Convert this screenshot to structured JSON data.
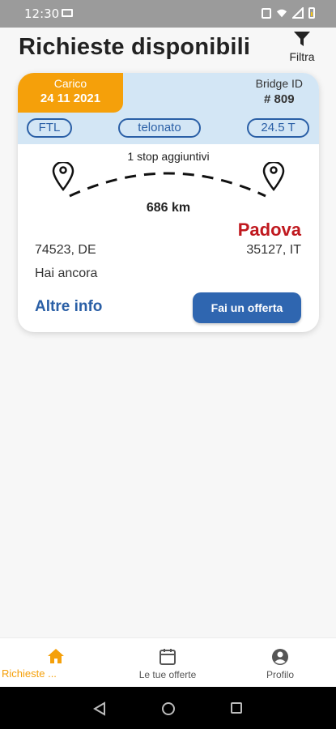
{
  "status_bar": {
    "time": "12:30"
  },
  "header": {
    "title": "Richieste disponibili",
    "filter_label": "Filtra"
  },
  "card": {
    "load_label": "Carico",
    "load_date": "24 11 2021",
    "bridge_label": "Bridge ID",
    "bridge_id": "# 809",
    "tags": [
      "FTL",
      "telonato",
      "24.5 T"
    ],
    "stops_text": "1 stop aggiuntivi",
    "distance": "686 km",
    "destination_city": "Padova",
    "origin_code": "74523, DE",
    "destination_code": "35127, IT",
    "remaining_text": "Hai ancora",
    "more_info": "Altre info",
    "offer_button": "Fai un offerta"
  },
  "bottom_nav": {
    "items": [
      {
        "label": "Richieste ...",
        "icon": "home-icon",
        "active": true
      },
      {
        "label": "Le tue offerte",
        "icon": "calendar-icon",
        "active": false
      },
      {
        "label": "Profilo",
        "icon": "account-icon",
        "active": false
      }
    ]
  },
  "colors": {
    "accent_orange": "#f5a00a",
    "primary_blue": "#2a5fa6",
    "destination_red": "#c0191f",
    "card_header_bg": "#d3e6f5"
  }
}
